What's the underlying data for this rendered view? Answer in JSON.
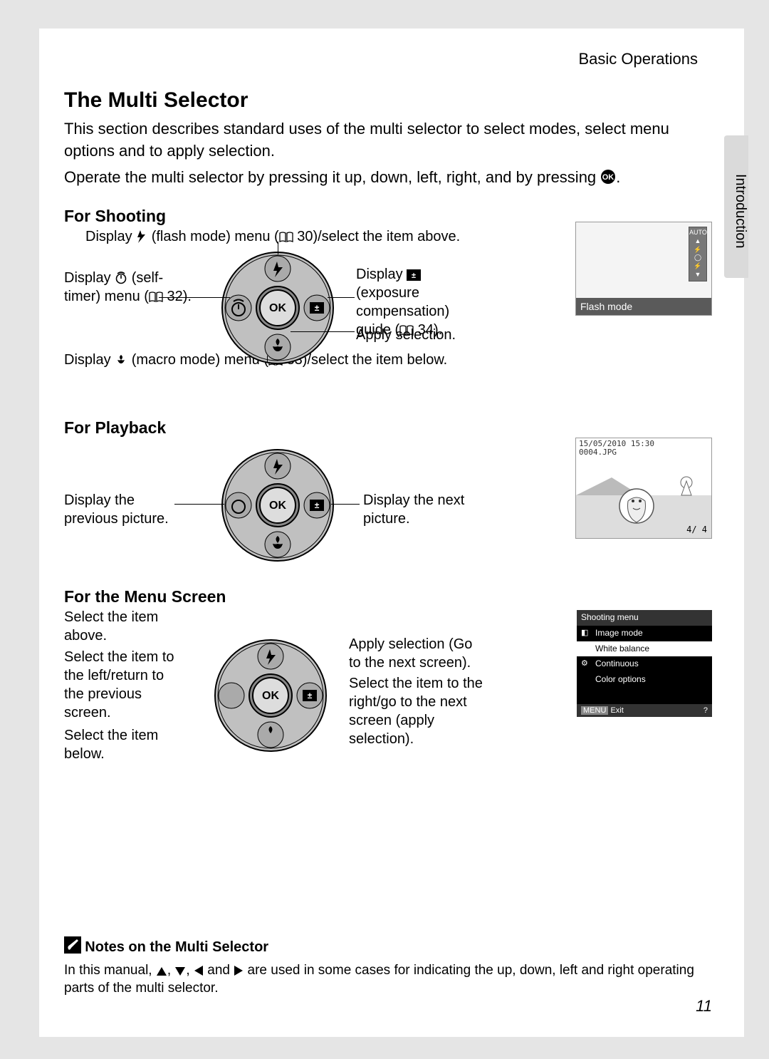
{
  "breadcrumb": "Basic Operations",
  "tab_label": "Introduction",
  "title": "The Multi Selector",
  "intro1": "This section describes standard uses of the multi selector to select modes, select menu options and to apply selection.",
  "intro2_a": "Operate the multi selector by pressing it up, down, left, right, and by pressing ",
  "intro2_b": ".",
  "shooting": {
    "heading": "For Shooting",
    "top_a": "Display ",
    "top_b": " (flash mode) menu (",
    "top_c": " 30)/select the item above.",
    "left_a": "Display ",
    "left_b": " (self-timer) menu (",
    "left_c": " 32).",
    "right_a": "Display ",
    "right_b": " (exposure compensation) guide (",
    "right_c": " 34).",
    "apply": "Apply selection.",
    "bottom_a": "Display ",
    "bottom_b": " (macro mode) menu (",
    "bottom_c": " 33)/select the item below.",
    "lcd_label": "Flash mode"
  },
  "playback": {
    "heading": "For Playback",
    "left": "Display the previous picture.",
    "right": "Display the next picture.",
    "date": "15/05/2010 15:30",
    "file": "0004.JPG",
    "counter": "4/  4"
  },
  "menu": {
    "heading": "For the Menu Screen",
    "l1": "Select the item above.",
    "l2": "Select the item to the left/return to the previous screen.",
    "l3": "Select the item below.",
    "r1": "Apply selection (Go to the next screen).",
    "r2": "Select the item to the right/go to the next screen (apply selection).",
    "lcd_title": "Shooting menu",
    "items": [
      "Image mode",
      "White balance",
      "Continuous",
      "Color options"
    ],
    "exit": "Exit"
  },
  "notes": {
    "title": "Notes on the Multi Selector",
    "body_a": "In this manual, ",
    "body_b": ", ",
    "body_c": ", ",
    "body_d": " and ",
    "body_e": " are used in some cases for indicating the up, down, left and right operating parts of the multi selector."
  },
  "page_number": "11"
}
